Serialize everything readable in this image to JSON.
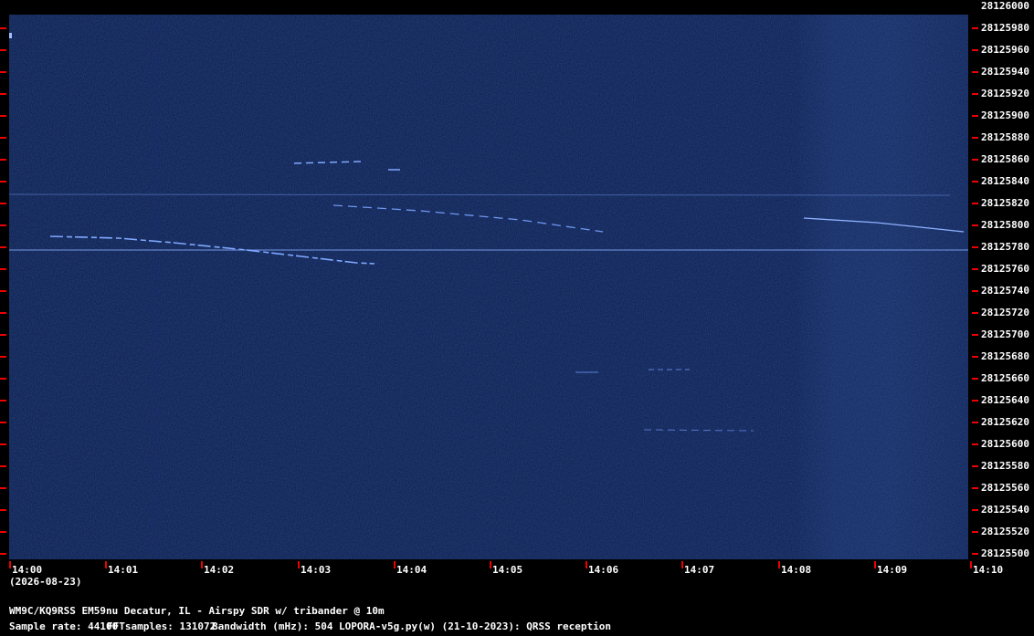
{
  "spectrogram": {
    "background_color": "#0a1a4a",
    "signal_color": "#7fa8ff"
  },
  "frequency_axis": {
    "labels": [
      "28126000",
      "28125980",
      "28125960",
      "28125940",
      "28125920",
      "28125900",
      "28125880",
      "28125860",
      "28125840",
      "28125820",
      "28125800",
      "28125780",
      "28125760",
      "28125740",
      "28125720",
      "28125700",
      "28125680",
      "28125660",
      "28125640",
      "28125620",
      "28125600",
      "28125580",
      "28125560",
      "28125540",
      "28125520",
      "28125500"
    ]
  },
  "time_axis": {
    "labels": [
      "14:00",
      "14:01",
      "14:02",
      "14:03",
      "14:04",
      "14:05",
      "14:06",
      "14:07",
      "14:08",
      "14:09",
      "14:10"
    ],
    "date": "(2026-08-23)"
  },
  "footer": {
    "station": "WM9C/KQ9RSS EM59nu Decatur, IL - Airspy SDR w/ tribander @ 10m",
    "sample_rate": "Sample rate: 44100",
    "fft_samples": "FFTsamples: 131072",
    "bandwidth": "Bandwidth (mHz): 504",
    "software": "LOPORA-v5g.py(w) (21-10-2023): QRSS reception"
  },
  "accent": {
    "tick_color": "#e00000"
  }
}
